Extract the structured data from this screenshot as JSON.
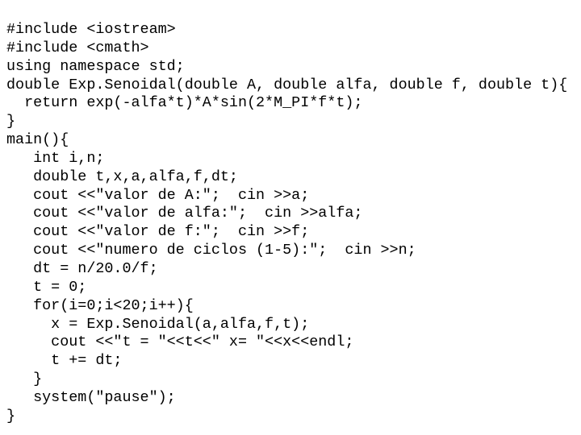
{
  "document": {
    "kind": "source-code-listing",
    "language": "C++",
    "background_color": "#ffffff",
    "text_color": "#000000",
    "lines": [
      "#include <iostream>",
      "#include <cmath>",
      "using namespace std;",
      "double Exp.Senoidal(double A, double alfa, double f, double t){",
      "  return exp(-alfa*t)*A*sin(2*M_PI*f*t);",
      "}",
      "main(){",
      "   int i,n;",
      "   double t,x,a,alfa,f,dt;",
      "   cout <<\"valor de A:\";  cin >>a;",
      "   cout <<\"valor de alfa:\";  cin >>alfa;",
      "   cout <<\"valor de f:\";  cin >>f;",
      "   cout <<\"numero de ciclos (1-5):\";  cin >>n;",
      "   dt = n/20.0/f;",
      "   t = 0;",
      "   for(i=0;i<20;i++){",
      "     x = Exp.Senoidal(a,alfa,f,t);",
      "     cout <<\"t = \"<<t<<\" x= \"<<x<<endl;",
      "     t += dt;",
      "   }",
      "   system(\"pause\");",
      "}"
    ]
  }
}
